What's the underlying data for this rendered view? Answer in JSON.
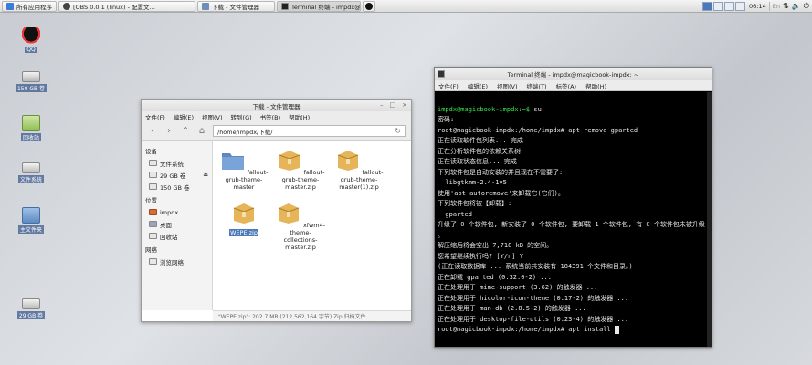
{
  "taskbar": {
    "items": [
      {
        "label": "所有应用程序",
        "icon": "apps-menu-icon"
      },
      {
        "label": "[OBS 0.0.1 (linux) - 配置文…",
        "icon": "obs-icon"
      },
      {
        "label": "下载 - 文件管理器",
        "icon": "folder-icon"
      },
      {
        "label": "Terminal 终端 - impdx@m…",
        "icon": "terminal-icon"
      }
    ],
    "clock": "06:14",
    "lang": "En"
  },
  "desktop": {
    "icons": [
      {
        "label": "QQ",
        "icon": "qq-icon"
      },
      {
        "label": "150 GB 卷",
        "icon": "drive-icon"
      },
      {
        "label": "回收站",
        "icon": "trash-icon"
      },
      {
        "label": "文件系统",
        "icon": "drive-icon"
      },
      {
        "label": "主文件夹",
        "icon": "home-folder-icon"
      },
      {
        "label": "29 GB 卷",
        "icon": "drive-icon"
      }
    ]
  },
  "filemanager": {
    "title": "下载 - 文件管理器",
    "menu": [
      "文件(F)",
      "编辑(E)",
      "视图(V)",
      "转到(G)",
      "书签(B)",
      "帮助(H)"
    ],
    "path": "/home/impdx/下载/",
    "sections": [
      {
        "heading": "设备",
        "items": [
          "文件系统",
          "29 GB 卷",
          "150 GB 卷"
        ]
      },
      {
        "heading": "位置",
        "items": [
          "impdx",
          "桌面",
          "回收站"
        ]
      },
      {
        "heading": "网络",
        "items": [
          "浏览网络"
        ]
      }
    ],
    "files": [
      {
        "name": "fallout-grub-theme-master",
        "type": "folder"
      },
      {
        "name": "fallout-grub-theme-master.zip",
        "type": "archive"
      },
      {
        "name": "fallout-grub-theme-master(1).zip",
        "type": "archive"
      },
      {
        "name": "WEPE.zip",
        "type": "archive",
        "selected": true
      },
      {
        "name": "xfwm4-theme-collections-master.zip",
        "type": "archive"
      }
    ],
    "status": "\"WEPE.zip\": 202.7 MB (212,562,164 字节) Zip 归档文件"
  },
  "terminal": {
    "title": "Terminal 终端 - impdx@magicbook-impdx: ~",
    "menu": [
      "文件(F)",
      "编辑(E)",
      "视图(V)",
      "终端(T)",
      "标签(A)",
      "帮助(H)"
    ],
    "lines": [
      {
        "prompt": "impdx@magicbook-impdx:~$",
        "text": " su"
      },
      {
        "text": "密码:"
      },
      {
        "text": "root@magicbook-impdx:/home/impdx# apt remove gparted"
      },
      {
        "text": "正在读取软件包列表... 完成"
      },
      {
        "text": "正在分析软件包的依赖关系树"
      },
      {
        "text": "正在读取状态信息... 完成"
      },
      {
        "text": "下列软件包是自动安装的并且现在不需要了:"
      },
      {
        "text": "  libgtkmm-2.4-1v5"
      },
      {
        "text": "使用'apt autoremove'来卸载它(它们)。"
      },
      {
        "text": "下列软件包将被【卸载】:"
      },
      {
        "text": "  gparted"
      },
      {
        "text": "升级了 0 个软件包, 新安装了 0 个软件包, 要卸载 1 个软件包, 有 0 个软件包未被升级"
      },
      {
        "text": "。"
      },
      {
        "text": "解压缩后将会空出 7,718 kB 的空间。"
      },
      {
        "text": "您希望继续执行吗? [Y/n] Y"
      },
      {
        "text": "(正在读取数据库 ... 系统当前共安装有 184391 个文件和目录。)"
      },
      {
        "text": "正在卸载 gparted (0.32.0-2) ..."
      },
      {
        "text": "正在处理用于 mime-support (3.62) 的触发器 ..."
      },
      {
        "text": "正在处理用于 hicolor-icon-theme (0.17-2) 的触发器 ..."
      },
      {
        "text": "正在处理用于 man-db (2.8.5-2) 的触发器 ..."
      },
      {
        "text": "正在处理用于 desktop-file-utils (0.23-4) 的触发器 ..."
      },
      {
        "text": "root@magicbook-impdx:/home/impdx# apt install"
      }
    ]
  }
}
